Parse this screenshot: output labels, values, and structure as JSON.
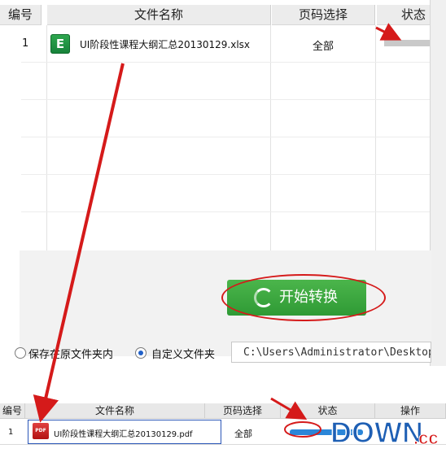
{
  "top_table": {
    "headers": {
      "num": "编号",
      "name": "文件名称",
      "page": "页码选择",
      "status": "状态"
    },
    "rows": [
      {
        "num": "1",
        "file_name": "UI阶段性课程大纲汇总20130129.xlsx",
        "page": "全部",
        "status_progress": 0
      }
    ],
    "excel_icon_letter": "E"
  },
  "start_button": {
    "label": "开始转换"
  },
  "save_options": {
    "option_original": "保存在原文件夹内",
    "option_custom": "自定义文件夹",
    "selected": "custom",
    "path_value": "C:\\Users\\Administrator\\Desktop"
  },
  "bottom_table": {
    "headers": {
      "num": "编号",
      "name": "文件名称",
      "page": "页码选择",
      "status": "状态",
      "action": "操作"
    },
    "rows": [
      {
        "num": "1",
        "file_name": "UI阶段性课程大纲汇总20130129.pdf",
        "page": "全部",
        "status_progress": 0.6
      }
    ],
    "pdf_icon_text": "PDF"
  },
  "watermark": {
    "text_main": "DOWN",
    "text_suffix": ".cc"
  },
  "colors": {
    "accent_green": "#3aa83c",
    "annotation_red": "#d51a1a",
    "progress_blue": "#2b86d8",
    "selection_border": "#2b57b8"
  }
}
